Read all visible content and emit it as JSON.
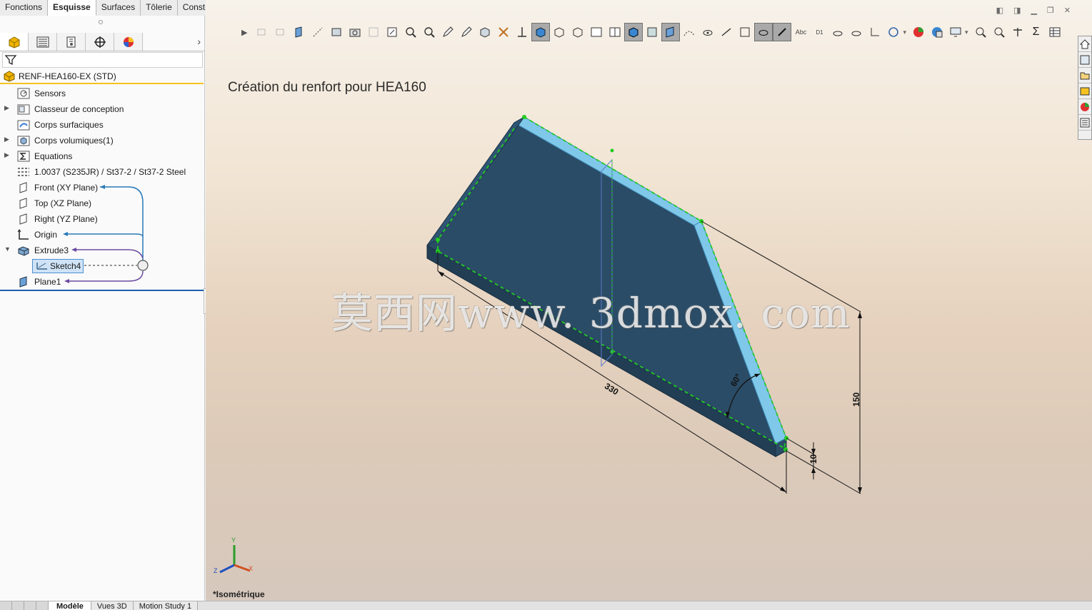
{
  "command_tabs": [
    "Fonctions",
    "Esquisse",
    "Surfaces",
    "Tôlerie",
    "Constructions soudées"
  ],
  "active_command_tab": "Esquisse",
  "tree": {
    "root": "RENF-HEA160-EX  (STD)",
    "items": [
      {
        "label": "Sensors",
        "expandable": false
      },
      {
        "label": "Classeur de conception",
        "expandable": true
      },
      {
        "label": "Corps surfaciques",
        "expandable": false
      },
      {
        "label": "Corps volumiques(1)",
        "expandable": true
      },
      {
        "label": "Equations",
        "expandable": true
      },
      {
        "label": "1.0037 (S235JR) / St37-2 / St37-2 Steel",
        "expandable": false
      },
      {
        "label": "Front (XY Plane)",
        "expandable": false
      },
      {
        "label": "Top (XZ Plane)",
        "expandable": false
      },
      {
        "label": "Right (YZ Plane)",
        "expandable": false
      },
      {
        "label": "Origin",
        "expandable": false
      },
      {
        "label": "Extrude3",
        "expandable": true
      },
      {
        "label": "Sketch4",
        "expandable": false
      },
      {
        "label": "Plane1",
        "expandable": false
      }
    ]
  },
  "viewport": {
    "title": "Création du renfort pour HEA160",
    "view_name": "*Isométrique",
    "watermark": "莫西网www. 3dmox. com",
    "dimensions": {
      "length": "330",
      "angle": "60°",
      "height": "150",
      "thickness": "10"
    },
    "triad": {
      "x": "X",
      "y": "Y",
      "z": "Z"
    }
  },
  "bottom_tabs": [
    "Modèle",
    "Vues 3D",
    "Motion Study 1"
  ],
  "active_bottom_tab": "Modèle",
  "colors": {
    "part_face": "#2b4c66",
    "part_edge": "#7fc8ea",
    "selection": "#22cc22",
    "accent": "#f5c220"
  }
}
